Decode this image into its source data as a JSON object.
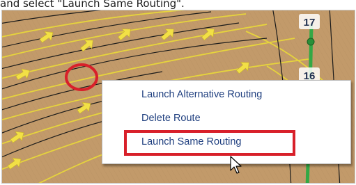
{
  "instruction": {
    "caption": "and select \"Launch Same Routing\"."
  },
  "map": {
    "route_numbers": [
      "17",
      "16"
    ],
    "colors": {
      "terrain": "#c29a6a",
      "contour": "#e6d43c",
      "route_line": "#1b1b1b",
      "vertical_route": "#33a845",
      "selection_circle": "#d8202a",
      "arrow": "#f2e046"
    }
  },
  "context_menu": {
    "items": [
      {
        "label": "Launch Alternative Routing"
      },
      {
        "label": "Delete Route"
      },
      {
        "label": "Launch Same Routing",
        "highlighted": true
      }
    ]
  },
  "annotations": {
    "highlight_color": "#d8202a",
    "icons": [
      "direction-arrow-icon",
      "route-waypoint-icon",
      "mouse-pointer-icon"
    ]
  }
}
